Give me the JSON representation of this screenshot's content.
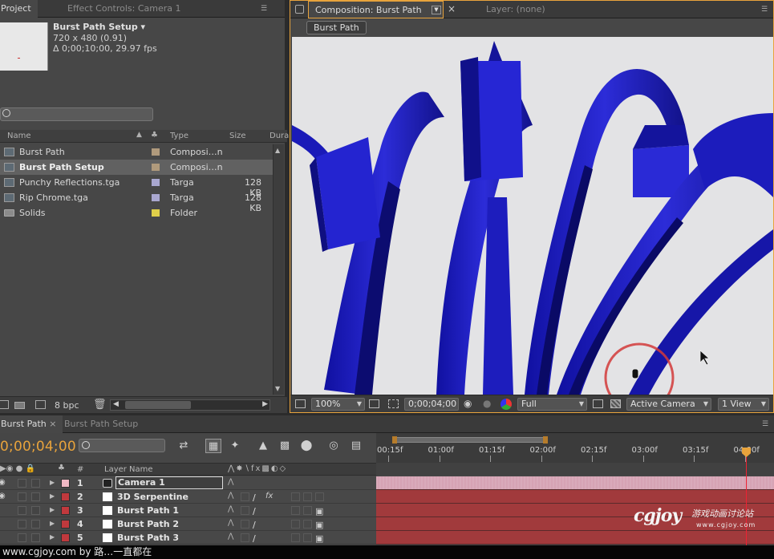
{
  "project_panel": {
    "tabs": [
      "Project",
      "Effect Controls: Camera 1"
    ],
    "info": {
      "name": "Burst Path Setup ▾",
      "resolution": "720 x 480 (0.91)",
      "duration": "Δ 0;00;10;00, 29.97 fps"
    },
    "columns": [
      "Name",
      "Type",
      "Size",
      "Dura"
    ],
    "items": [
      {
        "name": "Burst Path",
        "type": "Composi…n",
        "size": "",
        "color": "#b09a7c",
        "icon": "composition-icon",
        "selected": false
      },
      {
        "name": "Burst Path Setup",
        "type": "Composi…n",
        "size": "",
        "color": "#b09a7c",
        "icon": "composition-icon",
        "selected": true
      },
      {
        "name": "Punchy Reflections.tga",
        "type": "Targa",
        "size": "128 KB",
        "color": "#a9a7cf",
        "icon": "footage-icon",
        "selected": false
      },
      {
        "name": "Rip Chrome.tga",
        "type": "Targa",
        "size": "128 KB",
        "color": "#a9a7cf",
        "icon": "footage-icon",
        "selected": false
      },
      {
        "name": "Solids",
        "type": "Folder",
        "size": "",
        "color": "#e0cf4a",
        "icon": "folder-icon",
        "selected": false
      }
    ],
    "footer": {
      "bpc": "8 bpc"
    }
  },
  "comp_panel": {
    "tabs": [
      "Composition: Burst Path",
      "Layer: (none)"
    ],
    "breadcrumb": "Burst Path",
    "footer": {
      "zoom": "100%",
      "timecode": "0;00;04;00",
      "resolution": "Full",
      "camera": "Active Camera",
      "views": "1 View"
    }
  },
  "timeline": {
    "tabs": [
      "Burst Path",
      "Burst Path Setup"
    ],
    "current_time": "0;00;04;00",
    "ruler_labels": [
      "00:15f",
      "01:00f",
      "01:15f",
      "02:00f",
      "02:15f",
      "03:00f",
      "03:15f",
      "04:00f"
    ],
    "header": {
      "num": "#",
      "layer_name": "Layer Name"
    },
    "layers": [
      {
        "index": "1",
        "name": "Camera 1",
        "label_color": "#f0b8c4",
        "bar_color": "#d6a3b4",
        "editing": true,
        "source": "camera"
      },
      {
        "index": "2",
        "name": "3D Serpentine",
        "label_color": "#c0393d",
        "bar_color": "#a13a3c",
        "editing": false,
        "source": "solid"
      },
      {
        "index": "3",
        "name": "Burst Path 1",
        "label_color": "#c0393d",
        "bar_color": "#a13a3c",
        "editing": false,
        "source": "solid"
      },
      {
        "index": "4",
        "name": "Burst Path 2",
        "label_color": "#c0393d",
        "bar_color": "#a13a3c",
        "editing": false,
        "source": "solid"
      },
      {
        "index": "5",
        "name": "Burst Path 3",
        "label_color": "#c0393d",
        "bar_color": "#a13a3c",
        "editing": false,
        "source": "solid"
      }
    ]
  },
  "watermark": {
    "logo": "cgjoy",
    "tagline": "游戏动画讨论站",
    "url": "www.cgjoy.com"
  },
  "footer_caption": "www.cgjoy.com by 路…一直都在",
  "colors": {
    "accent": "#e8a33c",
    "panel": "#474747",
    "cti": "#ee2233",
    "object_blue": "#2020c8"
  }
}
